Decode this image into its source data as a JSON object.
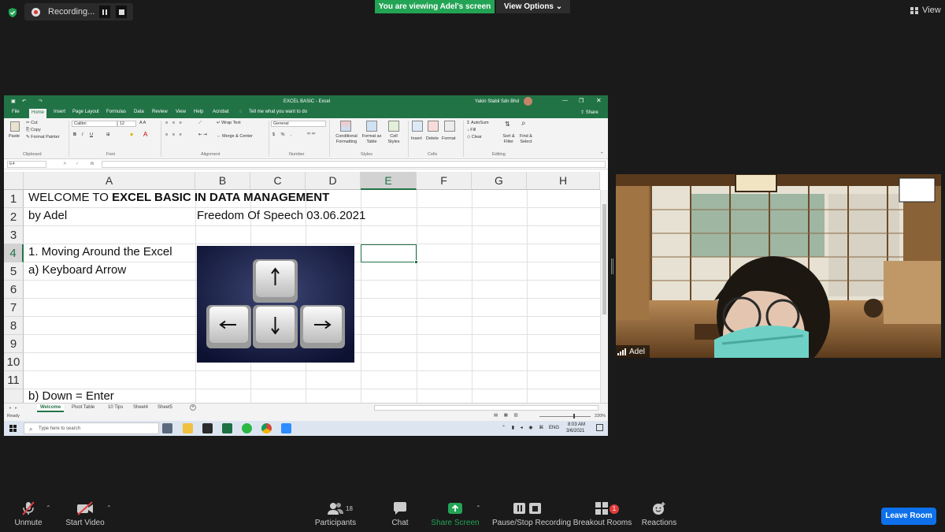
{
  "top_bar": {
    "recording_label": "Recording...",
    "viewing_banner": "You are viewing Adel's screen",
    "view_options_label": "View Options",
    "view_label": "View",
    "banner_color": "#23a455"
  },
  "excel": {
    "title": "EXCEL BASIC  -  Excel",
    "account": "Yakin Stabil Sdn Bhd",
    "share_label": "Share",
    "tabs": [
      "File",
      "Home",
      "Insert",
      "Page Layout",
      "Formulas",
      "Data",
      "Review",
      "View",
      "Help",
      "Acrobat"
    ],
    "tell_me": "Tell me what you want to do",
    "ribbon": {
      "paste": "Paste",
      "cut": "Cut",
      "copy": "Copy",
      "format_painter": "Format Painter",
      "clipboard": "Clipboard",
      "font_name": "Calibri",
      "font_size": "12",
      "font": "Font",
      "wrap_text": "Wrap Text",
      "merge_center": "Merge & Center",
      "alignment": "Alignment",
      "number_format": "General",
      "number": "Number",
      "conditional_formatting": "Conditional Formatting",
      "format_as_table": "Format as Table",
      "cell_styles": "Cell Styles",
      "styles": "Styles",
      "insert": "Insert",
      "delete": "Delete",
      "format": "Format",
      "cells": "Cells",
      "autosum": "AutoSum",
      "fill": "Fill",
      "clear": "Clear",
      "sort_filter": "Sort & Filter",
      "find_select": "Find & Select",
      "editing": "Editing"
    },
    "name_box": "E4",
    "fx_label": "fx",
    "columns": [
      "A",
      "B",
      "C",
      "D",
      "E",
      "F",
      "G",
      "H"
    ],
    "rows": [
      "1",
      "2",
      "3",
      "4",
      "5",
      "6",
      "7",
      "8",
      "9",
      "10",
      "11"
    ],
    "cells": {
      "a1_plain": "WELCOME TO ",
      "a1_bold": "EXCEL BASIC IN DATA MANAGEMENT",
      "a2": "by Adel",
      "b2": "Freedom Of Speech 03.06.2021",
      "a4": "1. Moving Around the Excel",
      "a5": "a) Keyboard Arrow",
      "a12": "b) Down = Enter"
    },
    "sheets": [
      "Welcome",
      "Pivot Table",
      "10 Tips",
      "Sheet4",
      "Sheet5"
    ],
    "status_ready": "Ready",
    "zoom": "220%",
    "search_placeholder": "Type here to search",
    "tray_lang": "ENG",
    "tray_time": "8:03 AM",
    "tray_date": "3/6/2021"
  },
  "webcam": {
    "participant_name": "Adel"
  },
  "toolbar": {
    "unmute": "Unmute",
    "start_video": "Start Video",
    "participants": "Participants",
    "participants_count": "18",
    "chat": "Chat",
    "share_screen": "Share Screen",
    "pause_stop_recording": "Pause/Stop Recording",
    "breakout_rooms": "Breakout Rooms",
    "breakout_badge": "1",
    "reactions": "Reactions",
    "leave_room": "Leave Room",
    "share_color": "#23a455",
    "leave_color": "#0e71eb"
  }
}
